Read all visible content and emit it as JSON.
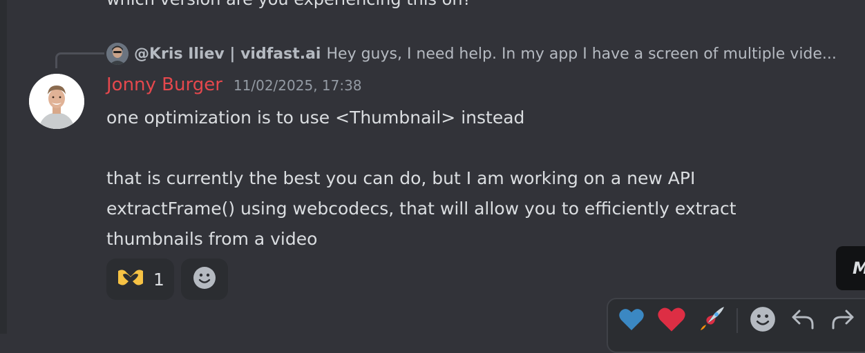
{
  "previous_message": {
    "text": "which version are you experiencing this on?"
  },
  "reply": {
    "author": "@Kris Iliev | vidfast.ai",
    "snippet": "Hey guys, I need help. In my app I have a screen of multiple vide..."
  },
  "message": {
    "author": "Jonny Burger",
    "author_color": "#e5484d",
    "timestamp": "11/02/2025, 17:38",
    "lines": [
      "one optimization is to use <Thumbnail> instead",
      "that is currently the best you can do, but I am working on a new API",
      "extractFrame() using webcodecs, that will allow you to efficiently extract",
      "thumbnails from a video"
    ]
  },
  "reactions": [
    {
      "icon": "heart-hands-emoji-icon",
      "count": "1"
    }
  ],
  "tooltip": {
    "text": "M"
  },
  "toolbar": {
    "buttons": [
      "blue-heart-emoji-icon",
      "red-heart-emoji-icon",
      "rocket-emoji-icon",
      "add-reaction-icon",
      "reply-icon",
      "forward-icon"
    ]
  }
}
